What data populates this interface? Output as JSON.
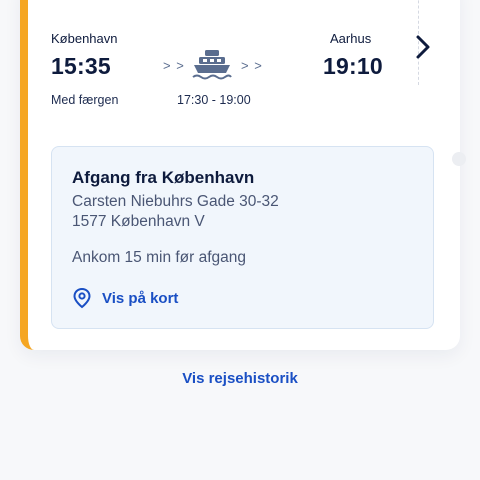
{
  "trip": {
    "from_city": "København",
    "to_city": "Aarhus",
    "depart_time": "15:35",
    "arrive_time": "19:10",
    "mode_label": "Med færgen",
    "ferry_window": "17:30 - 19:00",
    "chevrons": "> >"
  },
  "departure_box": {
    "title": "Afgang fra København",
    "address_line1": "Carsten Niebuhrs Gade 30-32",
    "address_line2": "1577 København V",
    "arrival_note": "Ankom 15 min før afgang",
    "map_link": "Vis på kort"
  },
  "history_link": "Vis rejsehistorik",
  "colors": {
    "accent": "#f5a623",
    "link": "#1a4fc4",
    "text_dark": "#0e1b3d",
    "box_bg": "#f1f6fc"
  },
  "icons": {
    "ferry": "ferry-icon",
    "next": "chevron-right-icon",
    "location": "location-pin-icon"
  }
}
